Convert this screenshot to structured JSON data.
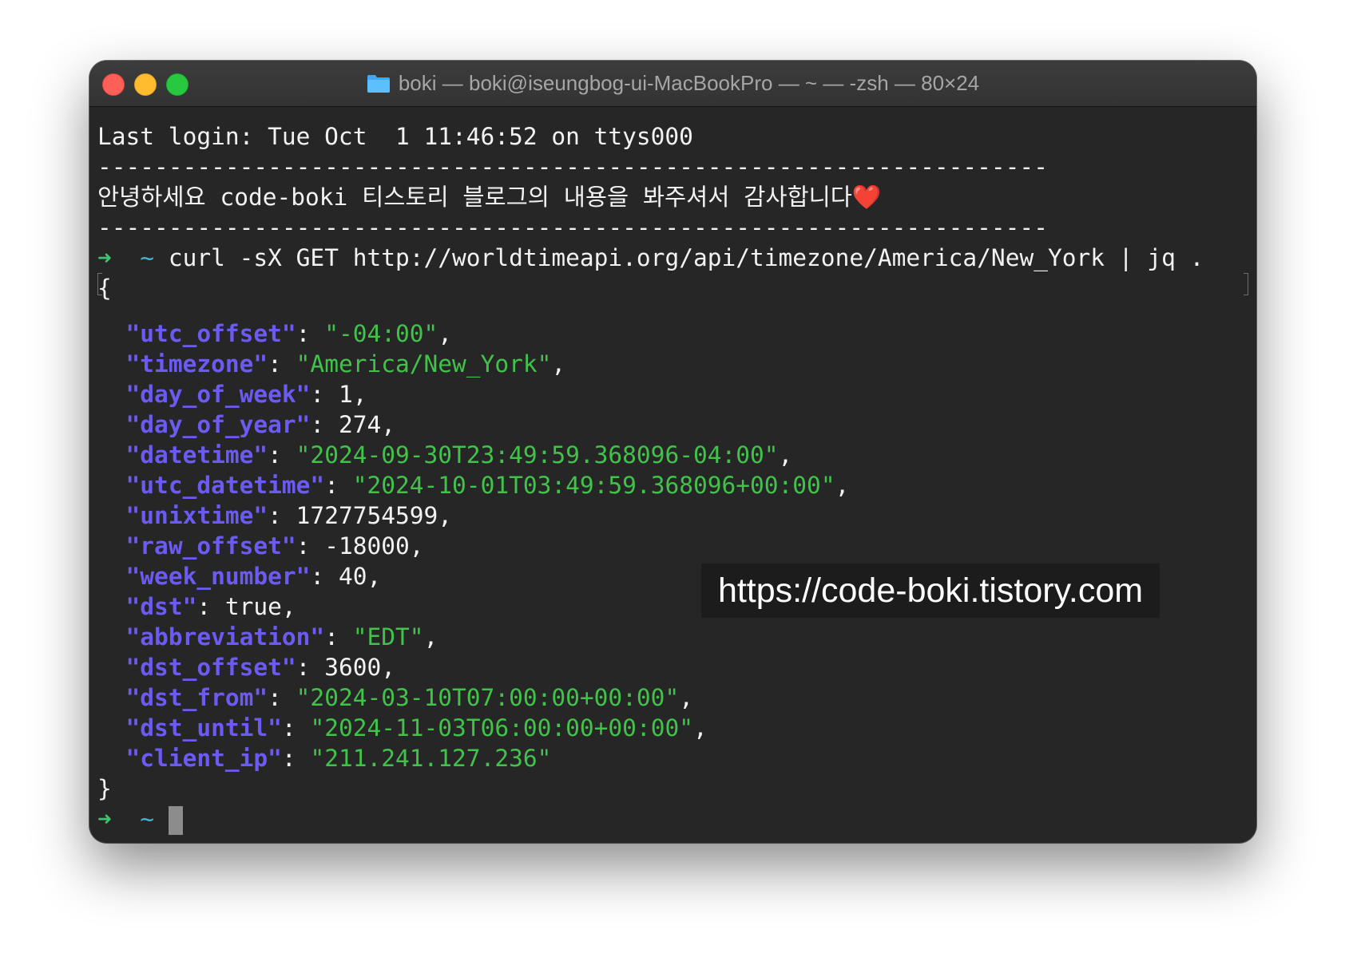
{
  "window": {
    "title": "boki — boki@iseungbog-ui-MacBookPro — ~ — -zsh — 80×24",
    "folder_icon": "folder-icon"
  },
  "terminal": {
    "login_line": "Last login: Tue Oct  1 11:46:52 on ttys000",
    "divider": "-------------------------------------------------------------------",
    "greeting": "안녕하세요 code-boki 티스토리 블로그의 내용을 봐주셔서 감사합니다",
    "greeting_emoji": "❤️",
    "prompt_arrow": "➜",
    "prompt_dir": "~",
    "command": "curl -sX GET http://worldtimeapi.org/api/timezone/America/New_York | jq .",
    "open_brace": "{",
    "close_brace": "}",
    "json_entries": [
      {
        "key": "utc_offset",
        "value": "-04:00",
        "type": "string"
      },
      {
        "key": "timezone",
        "value": "America/New_York",
        "type": "string"
      },
      {
        "key": "day_of_week",
        "value": "1",
        "type": "number"
      },
      {
        "key": "day_of_year",
        "value": "274",
        "type": "number"
      },
      {
        "key": "datetime",
        "value": "2024-09-30T23:49:59.368096-04:00",
        "type": "string"
      },
      {
        "key": "utc_datetime",
        "value": "2024-10-01T03:49:59.368096+00:00",
        "type": "string"
      },
      {
        "key": "unixtime",
        "value": "1727754599",
        "type": "number"
      },
      {
        "key": "raw_offset",
        "value": "-18000",
        "type": "number"
      },
      {
        "key": "week_number",
        "value": "40",
        "type": "number"
      },
      {
        "key": "dst",
        "value": "true",
        "type": "bool"
      },
      {
        "key": "abbreviation",
        "value": "EDT",
        "type": "string"
      },
      {
        "key": "dst_offset",
        "value": "3600",
        "type": "number"
      },
      {
        "key": "dst_from",
        "value": "2024-03-10T07:00:00+00:00",
        "type": "string"
      },
      {
        "key": "dst_until",
        "value": "2024-11-03T06:00:00+00:00",
        "type": "string"
      },
      {
        "key": "client_ip",
        "value": "211.241.127.236",
        "type": "string"
      }
    ]
  },
  "watermark": "https://code-boki.tistory.com",
  "colors": {
    "key": "#6b5bf2",
    "string": "#41c24a",
    "prompt_arrow": "#3ec46d",
    "prompt_dir": "#40b7cc",
    "background": "#262626"
  }
}
